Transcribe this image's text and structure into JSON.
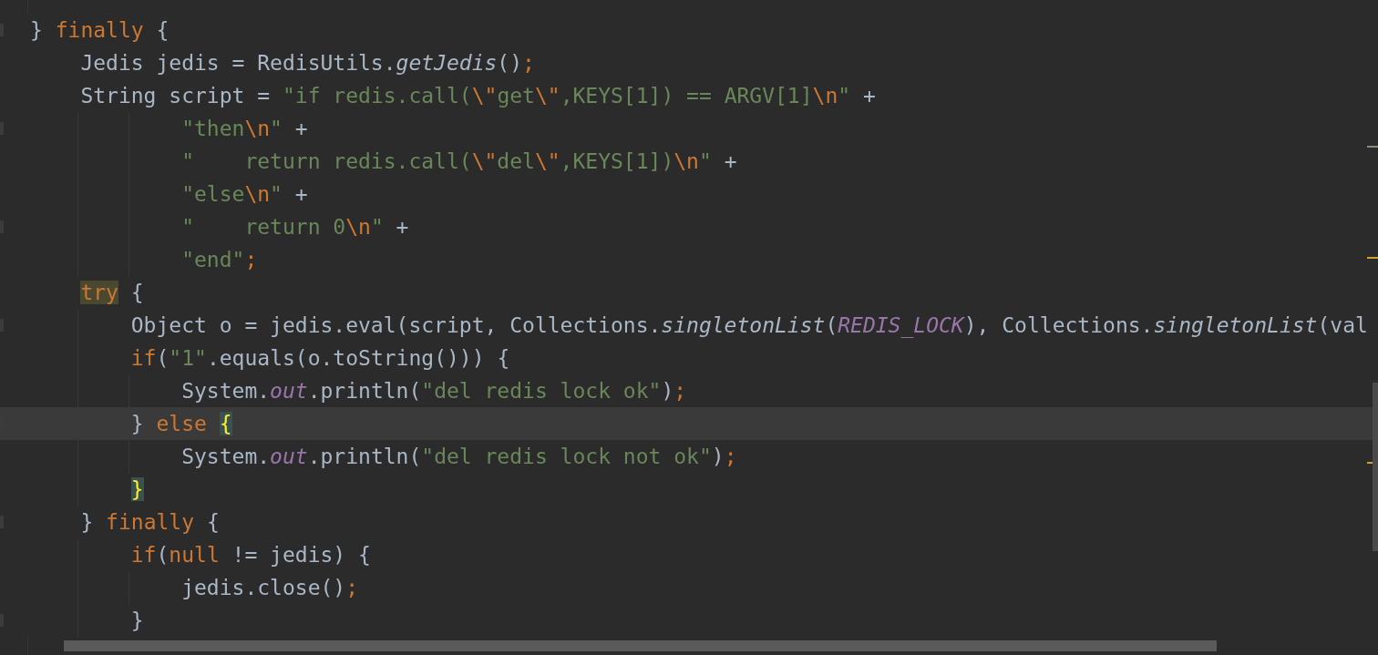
{
  "editor": {
    "lines": [
      {
        "current": false,
        "tokens": [
          {
            "kind": "plain",
            "text": "} "
          },
          {
            "kind": "kw",
            "text": "finally"
          },
          {
            "kind": "plain",
            "text": " {"
          }
        ]
      },
      {
        "current": false,
        "tokens": [
          {
            "kind": "plain",
            "text": "    Jedis jedis = RedisUtils."
          },
          {
            "kind": "method",
            "text": "getJedis"
          },
          {
            "kind": "plain",
            "text": "()"
          },
          {
            "kind": "kw",
            "text": ";"
          }
        ]
      },
      {
        "current": false,
        "tokens": [
          {
            "kind": "plain",
            "text": "    String script = "
          },
          {
            "kind": "str",
            "text": "\"if redis.call("
          },
          {
            "kind": "esc",
            "text": "\\\""
          },
          {
            "kind": "str",
            "text": "get"
          },
          {
            "kind": "esc",
            "text": "\\\""
          },
          {
            "kind": "str",
            "text": ",KEYS[1]) == ARGV[1]"
          },
          {
            "kind": "esc",
            "text": "\\n"
          },
          {
            "kind": "str",
            "text": "\""
          },
          {
            "kind": "plain",
            "text": " +"
          }
        ]
      },
      {
        "current": false,
        "tokens": [
          {
            "kind": "str",
            "text": "            \"then"
          },
          {
            "kind": "esc",
            "text": "\\n"
          },
          {
            "kind": "str",
            "text": "\""
          },
          {
            "kind": "plain",
            "text": " +"
          }
        ]
      },
      {
        "current": false,
        "tokens": [
          {
            "kind": "str",
            "text": "            \"    return redis.call("
          },
          {
            "kind": "esc",
            "text": "\\\""
          },
          {
            "kind": "str",
            "text": "del"
          },
          {
            "kind": "esc",
            "text": "\\\""
          },
          {
            "kind": "str",
            "text": ",KEYS[1])"
          },
          {
            "kind": "esc",
            "text": "\\n"
          },
          {
            "kind": "str",
            "text": "\""
          },
          {
            "kind": "plain",
            "text": " +"
          }
        ]
      },
      {
        "current": false,
        "tokens": [
          {
            "kind": "str",
            "text": "            \"else"
          },
          {
            "kind": "esc",
            "text": "\\n"
          },
          {
            "kind": "str",
            "text": "\""
          },
          {
            "kind": "plain",
            "text": " +"
          }
        ]
      },
      {
        "current": false,
        "tokens": [
          {
            "kind": "str",
            "text": "            \"    return 0"
          },
          {
            "kind": "esc",
            "text": "\\n"
          },
          {
            "kind": "str",
            "text": "\""
          },
          {
            "kind": "plain",
            "text": " +"
          }
        ]
      },
      {
        "current": false,
        "tokens": [
          {
            "kind": "str",
            "text": "            \"end\""
          },
          {
            "kind": "kw",
            "text": ";"
          }
        ]
      },
      {
        "current": false,
        "tokens": [
          {
            "kind": "kw-hl",
            "text": "    try"
          },
          {
            "kind": "plain",
            "text": " {"
          }
        ]
      },
      {
        "current": false,
        "tokens": [
          {
            "kind": "plain",
            "text": "        Object o = jedis.eval(script, Collections."
          },
          {
            "kind": "method",
            "text": "singletonList"
          },
          {
            "kind": "plain",
            "text": "("
          },
          {
            "kind": "const",
            "text": "REDIS_LOCK"
          },
          {
            "kind": "plain",
            "text": "), Collections."
          },
          {
            "kind": "method",
            "text": "singletonList"
          },
          {
            "kind": "plain",
            "text": "(val"
          }
        ]
      },
      {
        "current": false,
        "tokens": [
          {
            "kind": "kw",
            "text": "        if"
          },
          {
            "kind": "plain",
            "text": "("
          },
          {
            "kind": "str",
            "text": "\"1\""
          },
          {
            "kind": "plain",
            "text": ".equals(o.toString())) {"
          }
        ]
      },
      {
        "current": false,
        "tokens": [
          {
            "kind": "plain",
            "text": "            System."
          },
          {
            "kind": "const",
            "text": "out"
          },
          {
            "kind": "plain",
            "text": ".println("
          },
          {
            "kind": "str",
            "text": "\"del redis lock ok\""
          },
          {
            "kind": "plain",
            "text": ")"
          },
          {
            "kind": "kw",
            "text": ";"
          }
        ]
      },
      {
        "current": true,
        "tokens": [
          {
            "kind": "plain",
            "text": "        } "
          },
          {
            "kind": "kw",
            "text": "else"
          },
          {
            "kind": "brace-hl",
            "text": " {"
          }
        ]
      },
      {
        "current": false,
        "tokens": [
          {
            "kind": "plain",
            "text": "            System."
          },
          {
            "kind": "const",
            "text": "out"
          },
          {
            "kind": "plain",
            "text": ".println("
          },
          {
            "kind": "str",
            "text": "\"del redis lock not ok\""
          },
          {
            "kind": "plain",
            "text": ")"
          },
          {
            "kind": "kw",
            "text": ";"
          }
        ]
      },
      {
        "current": false,
        "tokens": [
          {
            "kind": "brace-hl",
            "text": "        }"
          }
        ]
      },
      {
        "current": false,
        "tokens": [
          {
            "kind": "plain",
            "text": "    } "
          },
          {
            "kind": "kw",
            "text": "finally"
          },
          {
            "kind": "plain",
            "text": " {"
          }
        ]
      },
      {
        "current": false,
        "tokens": [
          {
            "kind": "kw",
            "text": "        if"
          },
          {
            "kind": "plain",
            "text": "("
          },
          {
            "kind": "kw",
            "text": "null"
          },
          {
            "kind": "plain",
            "text": " != jedis) {"
          }
        ]
      },
      {
        "current": false,
        "tokens": [
          {
            "kind": "plain",
            "text": "            jedis.close()"
          },
          {
            "kind": "kw",
            "text": ";"
          }
        ]
      },
      {
        "current": false,
        "tokens": [
          {
            "kind": "plain",
            "text": "        }"
          }
        ]
      }
    ]
  }
}
